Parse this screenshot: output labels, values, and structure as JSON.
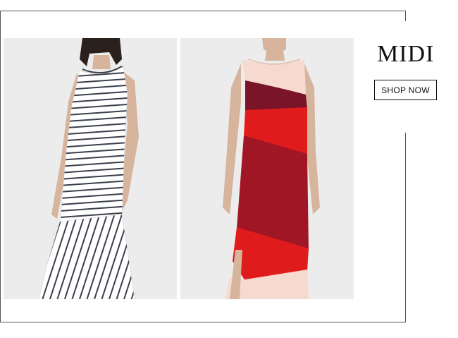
{
  "promo": {
    "title": "MIDI",
    "cta_label": "SHOP NOW"
  },
  "products": [
    {
      "image": "striped-sleeveless-midi-dress"
    },
    {
      "image": "colorblock-knit-midi-dress"
    }
  ],
  "colors": {
    "frame": "#555555",
    "panel_bg": "#ececec",
    "accent_red": "#e01b1b",
    "dark_red": "#a01624",
    "burgundy": "#7a1428",
    "blush": "#f6d9cf"
  }
}
